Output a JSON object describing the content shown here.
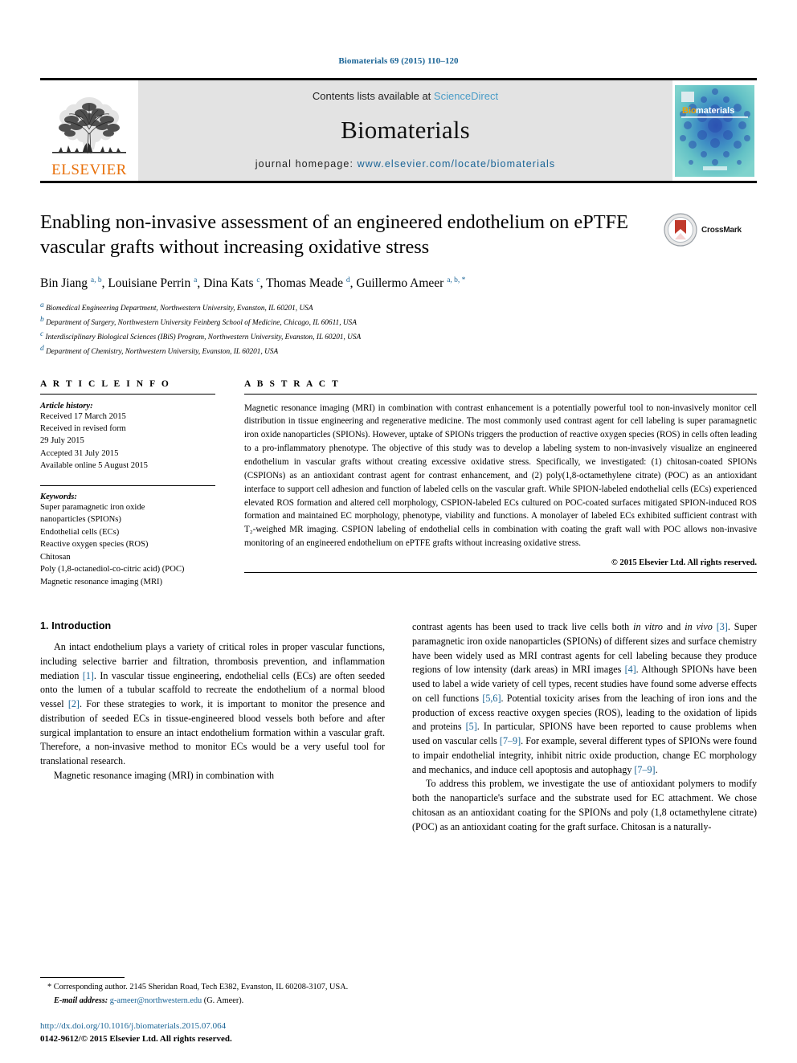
{
  "running_head": "Biomaterials 69 (2015) 110–120",
  "masthead": {
    "publisher": "ELSEVIER",
    "contents_prefix": "Contents lists available at ",
    "contents_link": "ScienceDirect",
    "journal_name": "Biomaterials",
    "homepage_prefix": "journal homepage: ",
    "homepage_url": "www.elsevier.com/locate/biomaterials",
    "cover_title_bio": "Bio",
    "cover_title_materials": "materials"
  },
  "article": {
    "title": "Enabling non-invasive assessment of an engineered endothelium on ePTFE vascular grafts without increasing oxidative stress",
    "crossmark_label": "CrossMark",
    "authors_html": "Bin Jiang <sup>a, b</sup>, Louisiane Perrin <sup>a</sup>, Dina Kats <sup>c</sup>, Thomas Meade <sup>d</sup>, Guillermo Ameer <sup>a, b, *</sup>",
    "affiliations": [
      "Biomedical Engineering Department, Northwestern University, Evanston, IL 60201, USA",
      "Department of Surgery, Northwestern University Feinberg School of Medicine, Chicago, IL 60611, USA",
      "Interdisciplinary Biological Sciences (IBiS) Program, Northwestern University, Evanston, IL 60201, USA",
      "Department of Chemistry, Northwestern University, Evanston, IL 60201, USA"
    ],
    "affiliation_marks": [
      "a",
      "b",
      "c",
      "d"
    ]
  },
  "article_info": {
    "heading": "A R T I C L E  I N F O",
    "history_label": "Article history:",
    "history": [
      "Received 17 March 2015",
      "Received in revised form",
      "29 July 2015",
      "Accepted 31 July 2015",
      "Available online 5 August 2015"
    ],
    "keywords_label": "Keywords:",
    "keywords": [
      "Super paramagnetic iron oxide",
      "nanoparticles (SPIONs)",
      "Endothelial cells (ECs)",
      "Reactive oxygen species (ROS)",
      "Chitosan",
      "Poly (1,8-octanediol-co-citric acid) (POC)",
      "Magnetic resonance imaging (MRI)"
    ]
  },
  "abstract": {
    "heading": "A B S T R A C T",
    "text": "Magnetic resonance imaging (MRI) in combination with contrast enhancement is a potentially powerful tool to non-invasively monitor cell distribution in tissue engineering and regenerative medicine. The most commonly used contrast agent for cell labeling is super paramagnetic iron oxide nanoparticles (SPIONs). However, uptake of SPIONs triggers the production of reactive oxygen species (ROS) in cells often leading to a pro-inflammatory phenotype. The objective of this study was to develop a labeling system to non-invasively visualize an engineered endothelium in vascular grafts without creating excessive oxidative stress. Specifically, we investigated: (1) chitosan-coated SPIONs (CSPIONs) as an antioxidant contrast agent for contrast enhancement, and (2) poly(1,8-octamethylene citrate) (POC) as an antioxidant interface to support cell adhesion and function of labeled cells on the vascular graft. While SPION-labeled endothelial cells (ECs) experienced elevated ROS formation and altered cell morphology, CSPION-labeled ECs cultured on POC-coated surfaces mitigated SPION-induced ROS formation and maintained EC morphology, phenotype, viability and functions. A monolayer of labeled ECs exhibited sufficient contrast with T₂-weighed MR imaging. CSPION labeling of endothelial cells in combination with coating the graft wall with POC allows non-invasive monitoring of an engineered endothelium on ePTFE grafts without increasing oxidative stress.",
    "copyright": "© 2015 Elsevier Ltd. All rights reserved."
  },
  "body": {
    "section_heading": "1. Introduction",
    "left_paragraph_1_html": "An intact endothelium plays a variety of critical roles in proper vascular functions, including selective barrier and filtration, thrombosis prevention, and inflammation mediation <span class=\"ref\">[1]</span>. In vascular tissue engineering, endothelial cells (ECs) are often seeded onto the lumen of a tubular scaffold to recreate the endothelium of a normal blood vessel <span class=\"ref\">[2]</span>. For these strategies to work, it is important to monitor the presence and distribution of seeded ECs in tissue-engineered blood vessels both before and after surgical implantation to ensure an intact endothelium formation within a vascular graft. Therefore, a non-invasive method to monitor ECs would be a very useful tool for translational research.",
    "left_paragraph_2_html": "Magnetic resonance imaging (MRI) in combination with",
    "right_paragraph_1_html": "contrast agents has been used to track live cells both <span class=\"it\">in vitro</span> and <span class=\"it\">in vivo</span> <span class=\"ref\">[3]</span>. Super paramagnetic iron oxide nanoparticles (SPIONs) of different sizes and surface chemistry have been widely used as MRI contrast agents for cell labeling because they produce regions of low intensity (dark areas) in MRI images <span class=\"ref\">[4]</span>. Although SPIONs have been used to label a wide variety of cell types, recent studies have found some adverse effects on cell functions <span class=\"ref\">[5,6]</span>. Potential toxicity arises from the leaching of iron ions and the production of excess reactive oxygen species (ROS), leading to the oxidation of lipids and proteins <span class=\"ref\">[5]</span>. In particular, SPIONS have been reported to cause problems when used on vascular cells <span class=\"ref\">[7–9]</span>. For example, several different types of SPIONs were found to impair endothelial integrity, inhibit nitric oxide production, change EC morphology and mechanics, and induce cell apoptosis and autophagy <span class=\"ref\">[7–9]</span>.",
    "right_paragraph_2_html": "To address this problem, we investigate the use of antioxidant polymers to modify both the nanoparticle's surface and the substrate used for EC attachment. We chose chitosan as an antioxidant coating for the SPIONs and poly (1,8 octamethylene citrate) (POC) as an antioxidant coating for the graft surface. Chitosan is a naturally-"
  },
  "footnote": {
    "corresponding_html": "<span class=\"lead\">* Corresponding author. 2145 Sheridan Road, Tech E382, Evanston, IL 60208-3107, USA.</span>",
    "email_label": "E-mail address:",
    "email": "g-ameer@northwestern.edu",
    "email_suffix": "(G. Ameer).",
    "doi": "http://dx.doi.org/10.1016/j.biomaterials.2015.07.064",
    "issn": "0142-9612/© 2015 Elsevier Ltd. All rights reserved."
  },
  "colors": {
    "link": "#1a6496",
    "sciencedirect": "#4a9cc7",
    "elsevier_orange": "#e8700a",
    "masthead_bg": "#e3e3e3"
  }
}
